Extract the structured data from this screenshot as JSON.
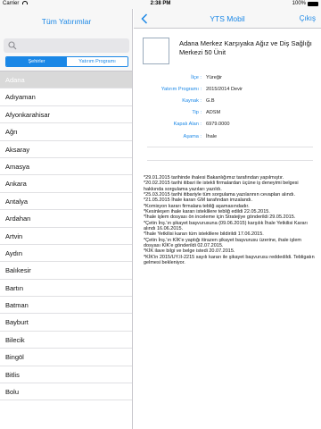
{
  "status_bar": {
    "carrier": "Carrier",
    "time": "2:38 PM",
    "battery": "100%"
  },
  "left_panel": {
    "title": "Tüm Yatırımlar",
    "search_placeholder": "",
    "segments": [
      "Şehirler",
      "Yatırım Programı"
    ],
    "selected_segment": 0,
    "cities": [
      "Adana",
      "Adıyaman",
      "Afyonkarahisar",
      "Ağrı",
      "Aksaray",
      "Amasya",
      "Ankara",
      "Antalya",
      "Ardahan",
      "Artvin",
      "Aydın",
      "Balıkesir",
      "Bartın",
      "Batman",
      "Bayburt",
      "Bilecik",
      "Bingöl",
      "Bitlis",
      "Bolu"
    ],
    "selected_city": "Adana"
  },
  "right_panel": {
    "title": "YTS Mobil",
    "exit_label": "Çıkış",
    "project_name": "Adana Merkez Karşıyaka Ağız ve Diş Sağlığı Merkezi 50 Ünit",
    "details": [
      {
        "label": "İlçe :",
        "value": "Yüreğir"
      },
      {
        "label": "Yatırım Programı :",
        "value": "2015/2014 Devir"
      },
      {
        "label": "Kaynak :",
        "value": "G.B"
      },
      {
        "label": "Tip :",
        "value": "ADSM"
      },
      {
        "label": "Kapalı Alan :",
        "value": "6979.0000"
      },
      {
        "label": "Aşama :",
        "value": "İhale"
      }
    ],
    "notes": [
      "*29.01.2015 tarihinde ihalesi Bakanlığımız tarafından yapılmıştır.",
      "*20.02.2015 tarihi itibari ile istekli firmalardan üçüne iş deneyimi belgesi hakkında sorgulama yazıları yazıldı.",
      "*25.03.2015 tarihi itibariyle tüm sorgulama yazılarının cevapları alındı.",
      "*21.05.2015 İhale kararı GM tarafından imzalandı.",
      "*Komisyon kararı firmalara tebliğ aşamasındadır.",
      "*Kesinleşen ihale kararı isteklilere tebliğ edildi 22.05.2015.",
      "*İhale işlem dosyası ön inceleme için Stratejiye gönderildi 29.05.2015.",
      "*Çetin İnş.'ın şikayet başvurusuna (09.06.2015) karşılık İhale Yetkilisi Kararı alındı 16.06.2015.",
      "*İhale Yetkilisi kararı tüm isteklilere bildirildi 17.06.2015.",
      "*Çetin İnş.'ın KİK'e yaptığı itirazen şikayet başvurusu üzerine, ihale işlem dosyası KİK'e gönderildi 02.07.2015.",
      "*KİK ilave bilgi ve belge istedi 20.07.2015.",
      "*KİK'in 2015/UY.II-2215 sayılı kararı ile şikayet başvurusu reddedildi. Tebligatın gelmesi bekleniyor."
    ]
  },
  "colors": {
    "accent": "#1a87e6",
    "header_bg": "#f7f7f7",
    "selected_row": "#d9d9d9"
  },
  "icons": [
    "search-icon",
    "back-chevron-icon",
    "wifi-icon",
    "battery-icon"
  ]
}
